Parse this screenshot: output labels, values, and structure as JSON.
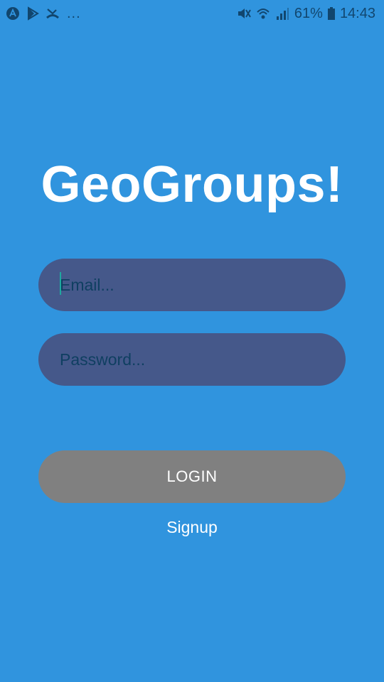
{
  "status_bar": {
    "left_icons": [
      "android-icon",
      "play-icon",
      "missed-call-icon"
    ],
    "overflow": "...",
    "right_icons": [
      "mute-icon",
      "wifi-icon",
      "signal-icon"
    ],
    "battery": "61%",
    "time": "14:43"
  },
  "app": {
    "title": "GeoGroups!"
  },
  "form": {
    "email_placeholder": "Email...",
    "password_placeholder": "Password...",
    "login_label": "LOGIN",
    "signup_label": "Signup"
  },
  "colors": {
    "background": "#3094de",
    "field": "#45588a",
    "button": "#808080",
    "caret": "#1fa8a0"
  }
}
